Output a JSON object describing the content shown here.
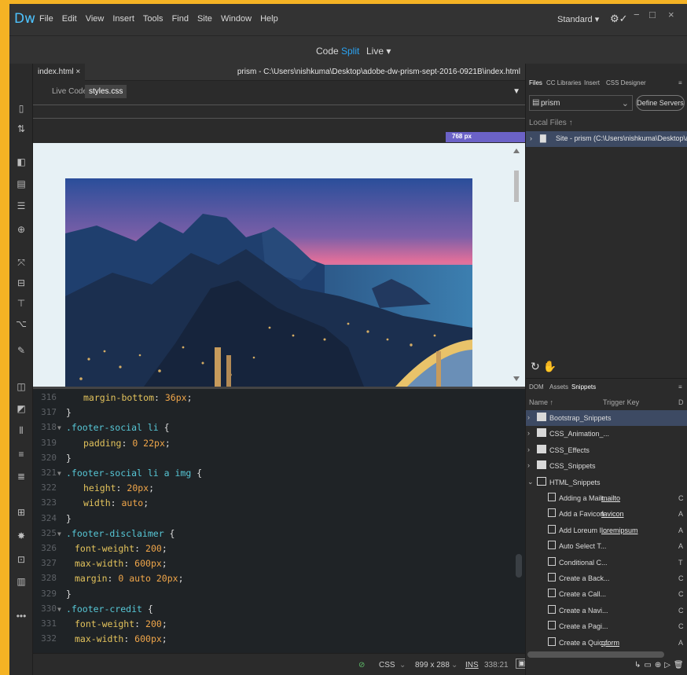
{
  "app": {
    "logo": "Dw",
    "menu": [
      "File",
      "Edit",
      "View",
      "Insert",
      "Tools",
      "Find",
      "Site",
      "Window",
      "Help"
    ],
    "workspace": "Standard ▾",
    "sync_icon": "⚙✓"
  },
  "views": {
    "code": "Code",
    "split": "Split",
    "live": "Live ▾"
  },
  "document": {
    "tab": "index.html ×",
    "path": "prism - C:\\Users\\nishkuma\\Desktop\\adobe-dw-prism-sept-2016-0921B\\index.html",
    "related": [
      "Live Code",
      "styles.css"
    ],
    "width_label": "768 px"
  },
  "code_lines": [
    {
      "n": "316",
      "fold": "",
      "indent": 4,
      "parts": [
        [
          "prop",
          "margin-bottom"
        ],
        [
          "punct",
          ": "
        ],
        [
          "val",
          "36px"
        ],
        [
          "punct",
          ";"
        ]
      ]
    },
    {
      "n": "317",
      "fold": "",
      "indent": 0,
      "parts": [
        [
          "punct",
          "}"
        ]
      ]
    },
    {
      "n": "318",
      "fold": "▼",
      "indent": 0,
      "parts": [
        [
          "sel",
          ".footer-social li"
        ],
        [
          "punct",
          " {"
        ]
      ]
    },
    {
      "n": "319",
      "fold": "",
      "indent": 4,
      "parts": [
        [
          "prop",
          "padding"
        ],
        [
          "punct",
          ": "
        ],
        [
          "val",
          "0 22px"
        ],
        [
          "punct",
          ";"
        ]
      ]
    },
    {
      "n": "320",
      "fold": "",
      "indent": 0,
      "parts": [
        [
          "punct",
          "}"
        ]
      ]
    },
    {
      "n": "321",
      "fold": "▼",
      "indent": 0,
      "parts": [
        [
          "sel",
          ".footer-social li a img"
        ],
        [
          "punct",
          " {"
        ]
      ]
    },
    {
      "n": "322",
      "fold": "",
      "indent": 4,
      "parts": [
        [
          "prop",
          "height"
        ],
        [
          "punct",
          ": "
        ],
        [
          "val",
          "20px"
        ],
        [
          "punct",
          ";"
        ]
      ]
    },
    {
      "n": "323",
      "fold": "",
      "indent": 4,
      "parts": [
        [
          "prop",
          "width"
        ],
        [
          "punct",
          ": "
        ],
        [
          "val",
          "auto"
        ],
        [
          "punct",
          ";"
        ]
      ]
    },
    {
      "n": "324",
      "fold": "",
      "indent": 0,
      "parts": [
        [
          "punct",
          "}"
        ]
      ]
    },
    {
      "n": "325",
      "fold": "▼",
      "indent": 0,
      "parts": [
        [
          "sel",
          ".footer-disclaimer"
        ],
        [
          "punct",
          " {"
        ]
      ]
    },
    {
      "n": "326",
      "fold": "",
      "indent": 2,
      "parts": [
        [
          "prop",
          "font-weight"
        ],
        [
          "punct",
          ": "
        ],
        [
          "val",
          "200"
        ],
        [
          "punct",
          ";"
        ]
      ]
    },
    {
      "n": "327",
      "fold": "",
      "indent": 2,
      "parts": [
        [
          "prop",
          "max-width"
        ],
        [
          "punct",
          ": "
        ],
        [
          "val",
          "600px"
        ],
        [
          "punct",
          ";"
        ]
      ]
    },
    {
      "n": "328",
      "fold": "",
      "indent": 2,
      "parts": [
        [
          "prop",
          "margin"
        ],
        [
          "punct",
          ": "
        ],
        [
          "val",
          "0 auto 20px"
        ],
        [
          "punct",
          ";"
        ]
      ]
    },
    {
      "n": "329",
      "fold": "",
      "indent": 0,
      "parts": [
        [
          "punct",
          "}"
        ]
      ]
    },
    {
      "n": "330",
      "fold": "▼",
      "indent": 0,
      "parts": [
        [
          "sel",
          ".footer-credit"
        ],
        [
          "punct",
          " {"
        ]
      ]
    },
    {
      "n": "331",
      "fold": "",
      "indent": 2,
      "parts": [
        [
          "prop",
          "font-weight"
        ],
        [
          "punct",
          ": "
        ],
        [
          "val",
          "200"
        ],
        [
          "punct",
          ";"
        ]
      ]
    },
    {
      "n": "332",
      "fold": "",
      "indent": 2,
      "parts": [
        [
          "prop",
          "max-width"
        ],
        [
          "punct",
          ": "
        ],
        [
          "val",
          "600px"
        ],
        [
          "punct",
          ";"
        ]
      ]
    }
  ],
  "status": {
    "language": "CSS",
    "size": "899 x 288",
    "mode": "INS",
    "position": "338:21"
  },
  "files_panel": {
    "tabs": [
      "Files",
      "CC Libraries",
      "Insert",
      "CSS Designer"
    ],
    "site": "prism",
    "define_servers": "Define Servers",
    "local_files": "Local Files ↑",
    "site_row": "Site - prism (C:\\Users\\nishkuma\\Desktop\\adobe..."
  },
  "snippets_panel": {
    "tabs": [
      "DOM",
      "Assets",
      "Snippets"
    ],
    "name_header": "Name ↑",
    "trigger_header": "Trigger Key",
    "desc_header": "D",
    "items": [
      {
        "label": "Bootstrap_Snippets",
        "kind": "folder",
        "open": false,
        "key": "",
        "trail": ""
      },
      {
        "label": "CSS_Animation_...",
        "kind": "folder",
        "open": false,
        "key": "",
        "trail": ""
      },
      {
        "label": "CSS_Effects",
        "kind": "folder",
        "open": false,
        "key": "",
        "trail": ""
      },
      {
        "label": "CSS_Snippets",
        "kind": "folder",
        "open": false,
        "key": "",
        "trail": ""
      },
      {
        "label": "HTML_Snippets",
        "kind": "folder",
        "open": true,
        "key": "",
        "trail": ""
      },
      {
        "label": "Adding a Mailt...",
        "kind": "file",
        "key": "mailto",
        "trail": "C"
      },
      {
        "label": "Add a Favicon",
        "kind": "file",
        "key": "favicon",
        "trail": "A"
      },
      {
        "label": "Add Loreum I...",
        "kind": "file",
        "key": "loremipsum",
        "trail": "A"
      },
      {
        "label": "Auto Select T...",
        "kind": "file",
        "key": "",
        "trail": "A"
      },
      {
        "label": "Conditional C...",
        "kind": "file",
        "key": "",
        "trail": "T"
      },
      {
        "label": "Create a Back...",
        "kind": "file",
        "key": "",
        "trail": "C"
      },
      {
        "label": "Create a Call...",
        "kind": "file",
        "key": "",
        "trail": "C"
      },
      {
        "label": "Create a Navi...",
        "kind": "file",
        "key": "",
        "trail": "C"
      },
      {
        "label": "Create a Pagi...",
        "kind": "file",
        "key": "",
        "trail": "C"
      },
      {
        "label": "Create a Quic...",
        "kind": "file",
        "key": "qform",
        "trail": "A"
      }
    ]
  },
  "colors": {
    "accent": "#4ec3ff",
    "split_active": "#2aa3f2",
    "width_bar": "#6b62c7",
    "selection": "#3d4a63"
  }
}
